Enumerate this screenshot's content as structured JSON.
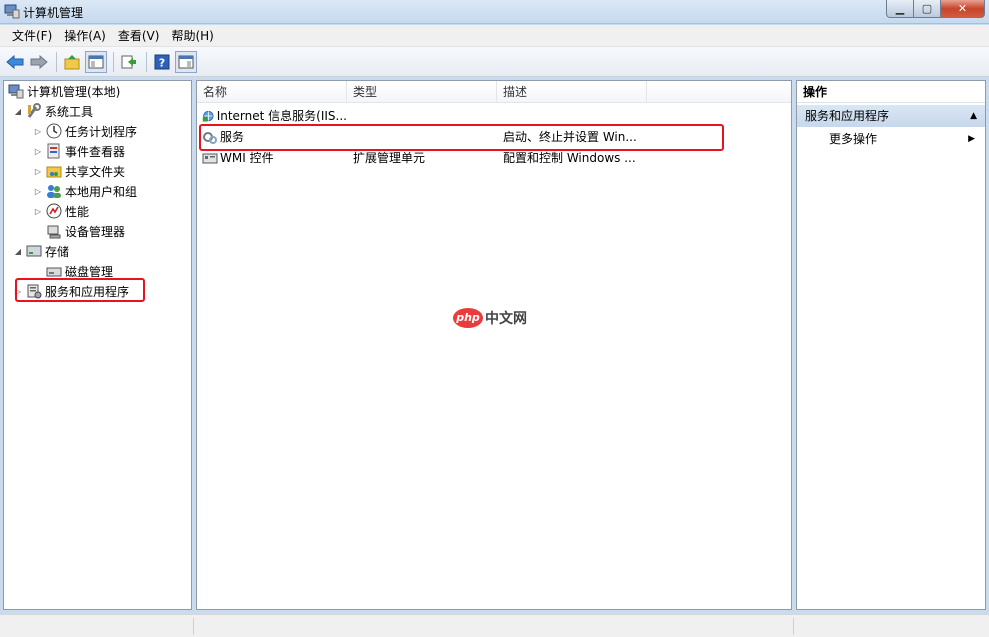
{
  "window": {
    "title": "计算机管理"
  },
  "menu": [
    "文件(F)",
    "操作(A)",
    "查看(V)",
    "帮助(H)"
  ],
  "tree": [
    {
      "label": "计算机管理(本地)",
      "level": 0,
      "toggle": "",
      "icon": "computer-management-icon"
    },
    {
      "label": "系统工具",
      "level": 1,
      "toggle": "◢",
      "icon": "system-tools-icon"
    },
    {
      "label": "任务计划程序",
      "level": 2,
      "toggle": "▷",
      "icon": "task-scheduler-icon"
    },
    {
      "label": "事件查看器",
      "level": 2,
      "toggle": "▷",
      "icon": "event-viewer-icon"
    },
    {
      "label": "共享文件夹",
      "level": 2,
      "toggle": "▷",
      "icon": "shared-folders-icon"
    },
    {
      "label": "本地用户和组",
      "level": 2,
      "toggle": "▷",
      "icon": "local-users-icon"
    },
    {
      "label": "性能",
      "level": 2,
      "toggle": "▷",
      "icon": "performance-icon"
    },
    {
      "label": "设备管理器",
      "level": 2,
      "toggle": "",
      "icon": "device-manager-icon"
    },
    {
      "label": "存储",
      "level": 1,
      "toggle": "◢",
      "icon": "storage-icon"
    },
    {
      "label": "磁盘管理",
      "level": 2,
      "toggle": "",
      "icon": "disk-management-icon"
    },
    {
      "label": "服务和应用程序",
      "level": 1,
      "toggle": "▷",
      "icon": "services-applications-icon"
    }
  ],
  "list": {
    "columns": [
      "名称",
      "类型",
      "描述"
    ],
    "rows": [
      {
        "name": "Internet 信息服务(IIS...",
        "type": "",
        "desc": "",
        "icon": "iis-icon"
      },
      {
        "name": "服务",
        "type": "",
        "desc": "启动、终止并设置 Win...",
        "icon": "services-icon"
      },
      {
        "name": "WMI 控件",
        "type": "扩展管理单元",
        "desc": "配置和控制 Windows ...",
        "icon": "wmi-control-icon"
      }
    ]
  },
  "actions": {
    "title": "操作",
    "section": "服务和应用程序",
    "more": "更多操作"
  },
  "watermark": {
    "badge": "php",
    "text": "中文网"
  },
  "colors": {
    "highlight": "#e8131f",
    "section_bg": "#c7d8ec"
  }
}
